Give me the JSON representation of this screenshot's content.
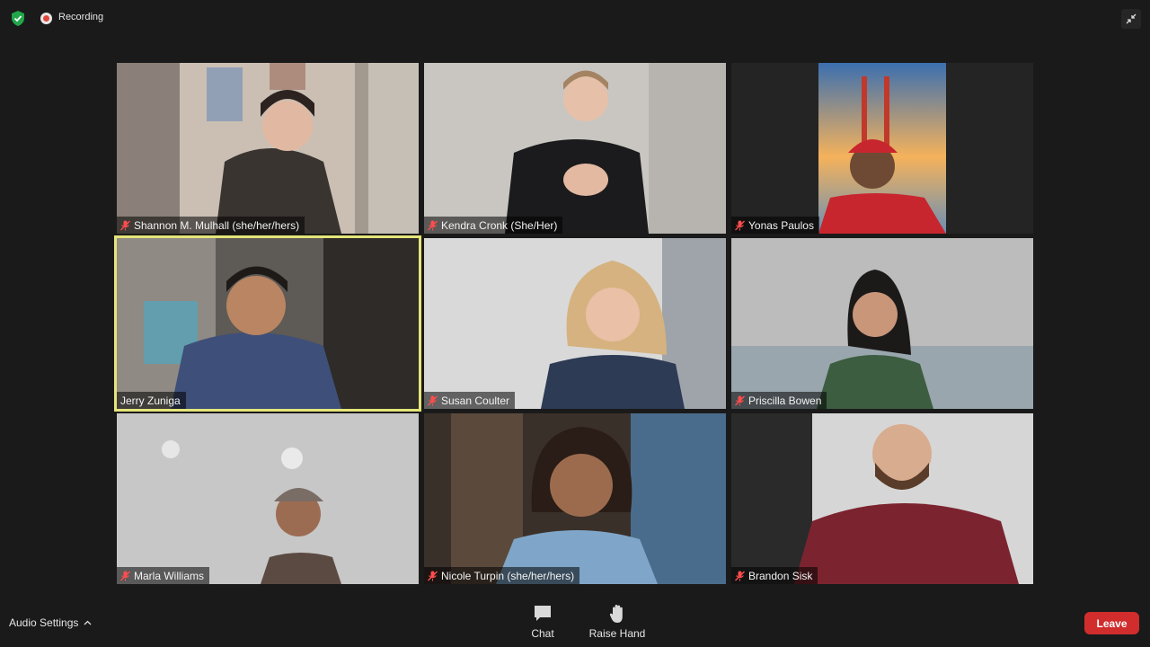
{
  "app": {
    "recording_label": "Recording",
    "accent_color": "#e5e57a",
    "leave_color": "#d12d2d"
  },
  "participants": [
    {
      "name": "Shannon M. Mulhall (she/her/hers)",
      "muted": true
    },
    {
      "name": "Kendra Cronk (She/Her)",
      "muted": true
    },
    {
      "name": "Yonas Paulos",
      "muted": true
    },
    {
      "name": "Jerry Zuniga",
      "muted": false,
      "active_speaker": true
    },
    {
      "name": "Susan Coulter",
      "muted": true
    },
    {
      "name": "Priscilla Bowen",
      "muted": true
    },
    {
      "name": "Marla Williams",
      "muted": true
    },
    {
      "name": "Nicole Turpin (she/her/hers)",
      "muted": true
    },
    {
      "name": "Brandon Sisk",
      "muted": true
    }
  ],
  "toolbar": {
    "audio_settings_label": "Audio Settings",
    "chat_label": "Chat",
    "raise_hand_label": "Raise Hand",
    "leave_label": "Leave"
  },
  "icons": [
    "shield-check-icon",
    "recording-icon",
    "exit-fullscreen-icon",
    "mic-muted-icon",
    "chevron-up-icon",
    "chat-icon",
    "raise-hand-icon"
  ]
}
